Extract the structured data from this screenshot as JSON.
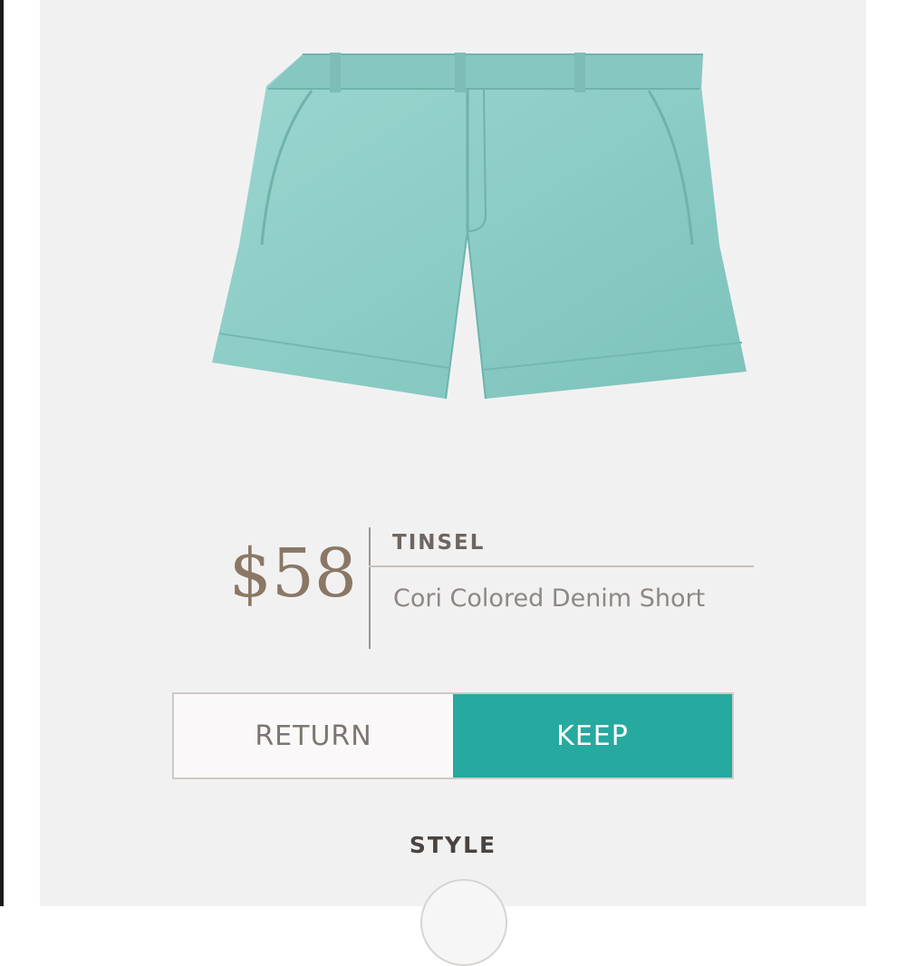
{
  "product": {
    "price": "$58",
    "brand": "TINSEL",
    "name": "Cori Colored Denim Short",
    "image_alt": "teal-denim-shorts"
  },
  "actions": {
    "return_label": "RETURN",
    "keep_label": "KEEP"
  },
  "section": {
    "style_label": "STYLE"
  },
  "colors": {
    "accent": "#26a99f",
    "price_text": "#8a7864",
    "shorts": "#8fcfc8",
    "card_background": "#f2f1f2"
  }
}
